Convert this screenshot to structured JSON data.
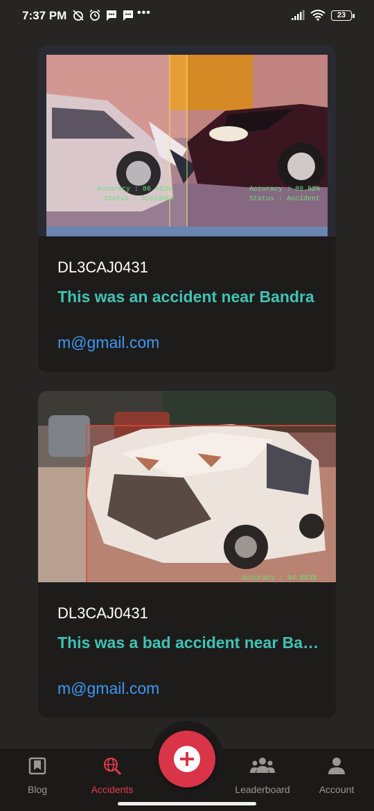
{
  "status_bar": {
    "time": "7:37 PM",
    "more_dots": "•••",
    "battery_level": "23"
  },
  "accidents": [
    {
      "plate": "DL3CAJ0431",
      "description": "This was an accident near Bandra",
      "email": "m@gmail.com",
      "overlay": {
        "left_accuracy": "Accuracy : 86.483%",
        "left_status": "Status : Accident",
        "right_accuracy": "Accuracy : 89.52%",
        "right_status": "Status : Accident"
      }
    },
    {
      "plate": "DL3CAJ0431",
      "description": "This was a bad accident near Bandra",
      "email": "m@gmail.com",
      "overlay": {
        "accuracy": "Accuracy : 94.663%"
      }
    }
  ],
  "bottom_nav": {
    "items": [
      {
        "label": "Blog",
        "icon": "bookmark-icon",
        "active": false
      },
      {
        "label": "Accidents",
        "icon": "globe-search-icon",
        "active": true
      },
      {
        "label": "Leaderboard",
        "icon": "group-icon",
        "active": false
      },
      {
        "label": "Account",
        "icon": "person-icon",
        "active": false
      }
    ],
    "fab_icon": "plus-icon"
  },
  "colors": {
    "background": "#262523",
    "card": "#1d1c1b",
    "description": "#3fc4b4",
    "email": "#3f97f2",
    "accent": "#d93448",
    "active_nav": "#e43d4c"
  }
}
